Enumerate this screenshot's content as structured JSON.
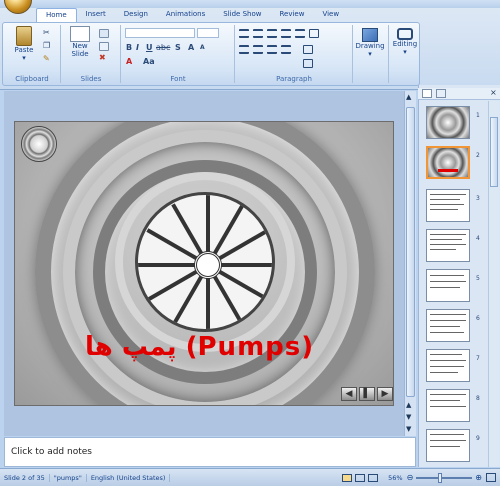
{
  "tabs": [
    "Home",
    "Insert",
    "Design",
    "Animations",
    "Slide Show",
    "Review",
    "View"
  ],
  "active_tab": "Home",
  "ribbon": {
    "clipboard": {
      "label": "Clipboard",
      "paste": "Paste"
    },
    "slides": {
      "label": "Slides",
      "new_slide": "New\nSlide"
    },
    "font": {
      "label": "Font",
      "bold": "B",
      "italic": "I",
      "underline": "U",
      "strike": "abc",
      "shadow": "S",
      "size_up": "A",
      "size_down": "A",
      "color": "A",
      "case": "Aa"
    },
    "paragraph": {
      "label": "Paragraph"
    },
    "drawing": {
      "label": "Drawing"
    },
    "editing": {
      "label": "Editing"
    }
  },
  "slide": {
    "title": "پمپ ها  (Pumps)",
    "nav": [
      "◀",
      "▌",
      "▶"
    ]
  },
  "notes": {
    "placeholder": "Click to add notes"
  },
  "thumbnails": {
    "panel_tab": "×",
    "numbers": [
      "1",
      "2",
      "3",
      "4",
      "5",
      "6",
      "7",
      "8",
      "9"
    ],
    "selected": 2
  },
  "status": {
    "slide": "Slide 2 of 35",
    "theme": "\"pumps\"",
    "language": "English (United States)",
    "zoom": "56%"
  }
}
